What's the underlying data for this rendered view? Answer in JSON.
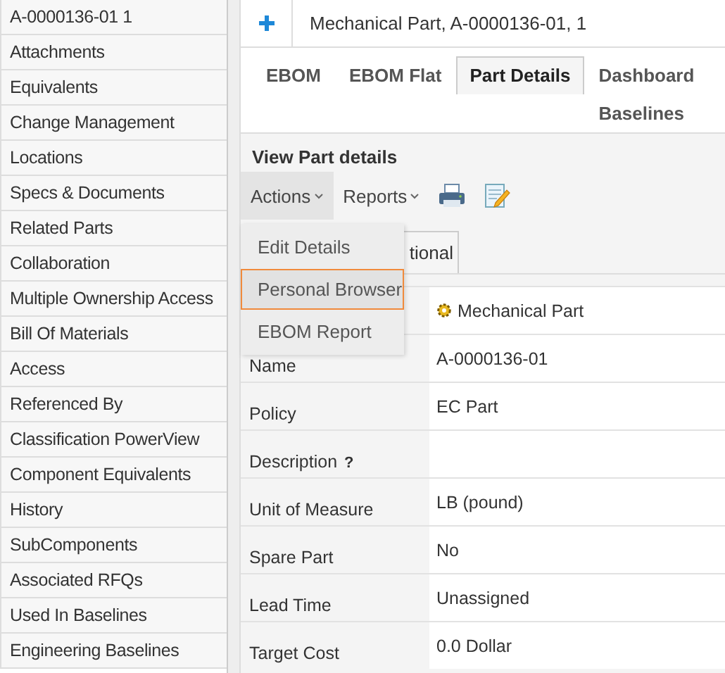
{
  "sidebar": {
    "items": [
      {
        "label": "A-0000136-01 1"
      },
      {
        "label": "Attachments"
      },
      {
        "label": "Equivalents"
      },
      {
        "label": "Change Management"
      },
      {
        "label": "Locations"
      },
      {
        "label": "Specs & Documents"
      },
      {
        "label": "Related Parts"
      },
      {
        "label": "Collaboration"
      },
      {
        "label": "Multiple Ownership Access"
      },
      {
        "label": "Bill Of Materials"
      },
      {
        "label": "Access"
      },
      {
        "label": "Referenced By"
      },
      {
        "label": "Classification PowerView"
      },
      {
        "label": "Component Equivalents"
      },
      {
        "label": "History"
      },
      {
        "label": "SubComponents"
      },
      {
        "label": "Associated RFQs"
      },
      {
        "label": "Used In Baselines"
      },
      {
        "label": "Engineering Baselines"
      }
    ]
  },
  "header": {
    "title": "Mechanical Part, A-0000136-01, 1"
  },
  "tabs": [
    {
      "label": "EBOM",
      "selected": false
    },
    {
      "label": "EBOM Flat",
      "selected": false
    },
    {
      "label": "Part Details",
      "selected": true
    },
    {
      "label": "Dashboard",
      "selected": false
    },
    {
      "label": "Baselines",
      "selected": false
    }
  ],
  "section_title": "View Part details",
  "toolbar": {
    "menus": [
      {
        "label": "Actions",
        "open": true
      },
      {
        "label": "Reports",
        "open": false
      }
    ]
  },
  "actions_menu": [
    {
      "label": "Edit Details",
      "highlighted": false
    },
    {
      "label": "Personal Browser",
      "highlighted": true
    },
    {
      "label": "EBOM Report",
      "highlighted": false
    }
  ],
  "sub_tabs": [
    {
      "label": "tional"
    }
  ],
  "properties": [
    {
      "value": "Mechanical Part",
      "kind": "type"
    },
    {
      "label": "Name",
      "value": "A-0000136-01",
      "kind": "text"
    },
    {
      "label": "Policy",
      "value": "EC Part",
      "kind": "text"
    },
    {
      "label": "Description",
      "hint": "?",
      "kind": "text"
    },
    {
      "label": "Unit of Measure",
      "value": "LB (pound)",
      "kind": "text"
    },
    {
      "label": "Spare Part",
      "value": "No",
      "kind": "text"
    },
    {
      "label": "Lead Time",
      "value": "Unassigned",
      "kind": "text"
    },
    {
      "label": "Target Cost",
      "value": "0.0 Dollar",
      "kind": "text"
    }
  ]
}
